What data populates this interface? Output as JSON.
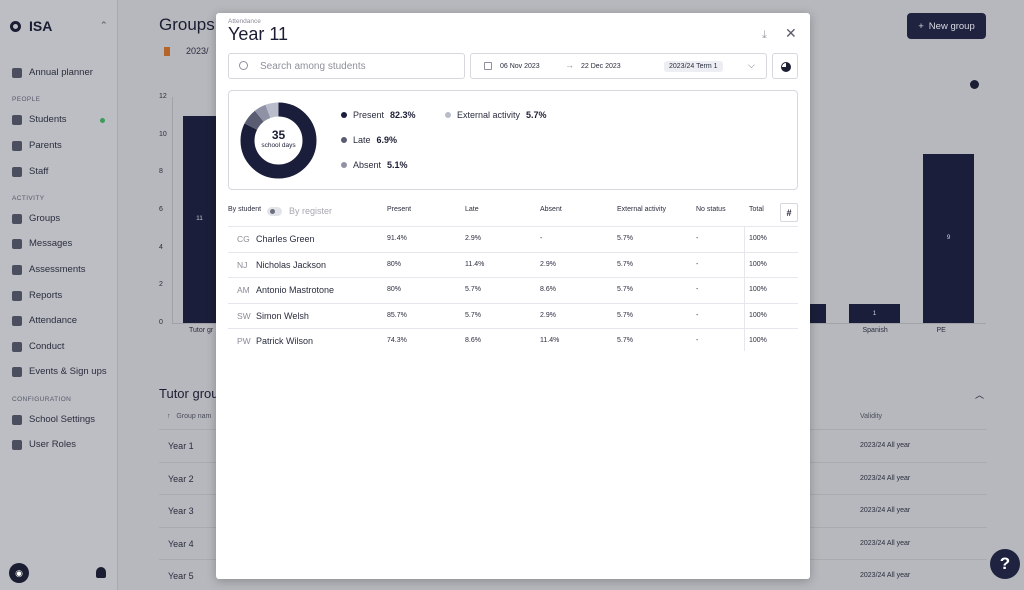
{
  "app": {
    "name": "ISA"
  },
  "sidebar": {
    "top_items": [
      {
        "label": "Annual planner",
        "icon": "calendar-icon"
      }
    ],
    "sections": [
      {
        "label": "PEOPLE",
        "items": [
          {
            "label": "Students",
            "icon": "students-icon"
          },
          {
            "label": "Parents",
            "icon": "parents-icon"
          },
          {
            "label": "Staff",
            "icon": "staff-icon"
          }
        ]
      },
      {
        "label": "ACTIVITY",
        "items": [
          {
            "label": "Groups",
            "icon": "groups-icon"
          },
          {
            "label": "Messages",
            "icon": "messages-icon"
          },
          {
            "label": "Assessments",
            "icon": "assessments-icon"
          },
          {
            "label": "Reports",
            "icon": "reports-icon"
          },
          {
            "label": "Attendance",
            "icon": "attendance-icon"
          },
          {
            "label": "Conduct",
            "icon": "conduct-icon"
          },
          {
            "label": "Events & Sign ups",
            "icon": "events-icon"
          }
        ]
      },
      {
        "label": "CONFIGURATION",
        "items": [
          {
            "label": "School Settings",
            "icon": "settings-icon"
          },
          {
            "label": "User Roles",
            "icon": "roles-icon"
          }
        ]
      }
    ],
    "status_color": "#3d9b5e"
  },
  "main": {
    "title": "Groups",
    "new_group_label": "New group",
    "filter_value": "2023/",
    "chart_data": {
      "type": "bar",
      "ylim": [
        0,
        12
      ],
      "yticks": [
        0,
        2,
        4,
        6,
        8,
        10,
        12
      ],
      "categories": [
        "Tutor gr",
        "",
        "Spanish",
        "PE"
      ],
      "values": [
        11,
        1,
        1,
        9
      ],
      "color": "#1b1e3a"
    },
    "tutor_groups": {
      "title": "Tutor group",
      "col_group": "Group nam",
      "col_validity": "Validity",
      "rows": [
        {
          "name": "Year 1",
          "validity": "2023/24 All year"
        },
        {
          "name": "Year 2",
          "validity": "2023/24 All year"
        },
        {
          "name": "Year 3",
          "validity": "2023/24 All year"
        },
        {
          "name": "Year 4",
          "validity": "2023/24 All year"
        },
        {
          "name": "Year 5",
          "validity": "2023/24 All year"
        }
      ]
    },
    "help_label": "?"
  },
  "modal": {
    "subtitle": "Attendance",
    "title": "Year 11",
    "search_placeholder": "Search among students",
    "date_from": "06 Nov 2023",
    "date_to": "22 Dec 2023",
    "term": "2023/24 Term 1",
    "summary": {
      "days": "35",
      "days_label": "school days",
      "legend": [
        {
          "label": "Present",
          "value": "82.3%",
          "fraction": 0.823,
          "color": "#1b1e3a"
        },
        {
          "label": "Late",
          "value": "6.9%",
          "fraction": 0.069,
          "color": "#5a5d72"
        },
        {
          "label": "Absent",
          "value": "5.1%",
          "fraction": 0.051,
          "color": "#8f92a5"
        },
        {
          "label": "External activity",
          "value": "5.7%",
          "fraction": 0.057,
          "color": "#b9bccb"
        }
      ]
    },
    "table": {
      "by_student": "By student",
      "by_register": "By register",
      "columns": [
        "Present",
        "Late",
        "Absent",
        "External activity",
        "No status",
        "Total"
      ],
      "hash": "#",
      "rows": [
        {
          "initials": "CG",
          "name": "Charles Green",
          "present": "91.4%",
          "late": "2.9%",
          "absent": "-",
          "external": "5.7%",
          "nostatus": "-",
          "total": "100%"
        },
        {
          "initials": "NJ",
          "name": "Nicholas Jackson",
          "present": "80%",
          "late": "11.4%",
          "absent": "2.9%",
          "external": "5.7%",
          "nostatus": "-",
          "total": "100%"
        },
        {
          "initials": "AM",
          "name": "Antonio Mastrotone",
          "present": "80%",
          "late": "5.7%",
          "absent": "8.6%",
          "external": "5.7%",
          "nostatus": "-",
          "total": "100%"
        },
        {
          "initials": "SW",
          "name": "Simon Welsh",
          "present": "85.7%",
          "late": "5.7%",
          "absent": "2.9%",
          "external": "5.7%",
          "nostatus": "-",
          "total": "100%"
        },
        {
          "initials": "PW",
          "name": "Patrick Wilson",
          "present": "74.3%",
          "late": "8.6%",
          "absent": "11.4%",
          "external": "5.7%",
          "nostatus": "-",
          "total": "100%"
        }
      ]
    }
  }
}
